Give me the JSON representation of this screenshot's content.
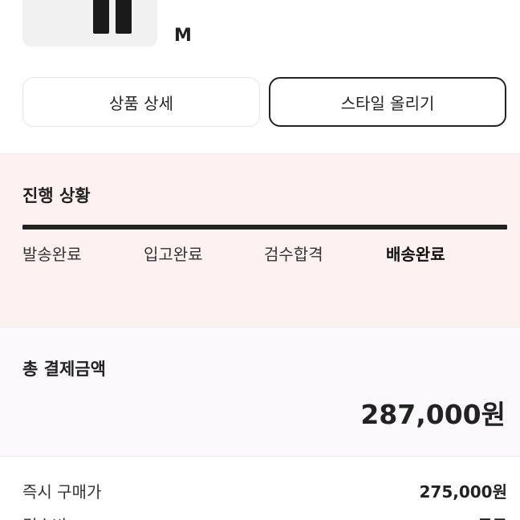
{
  "product": {
    "size": "M"
  },
  "actions": {
    "detail_label": "상품 상세",
    "style_label": "스타일 올리기"
  },
  "progress": {
    "title": "진행 상황",
    "steps": [
      "발송완료",
      "입고완료",
      "검수합격",
      "배송완료"
    ],
    "current_step": "배송완료"
  },
  "payment": {
    "total_label": "총 결제금액",
    "total_amount": "287,000원",
    "rows": [
      {
        "label": "즉시 구매가",
        "value": "275,000원"
      },
      {
        "label": "검수비",
        "value": "무료"
      }
    ]
  },
  "colors": {
    "progress_bg": "#fdf1f1",
    "total_bg": "#faf8fb",
    "text": "#222222"
  }
}
